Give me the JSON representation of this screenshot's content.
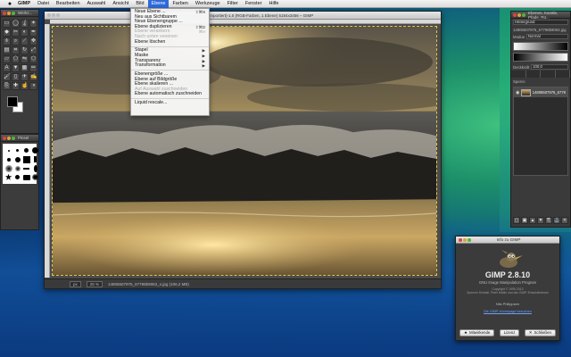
{
  "menubar": {
    "apple": "",
    "app": "GIMP",
    "items": [
      "Datei",
      "Bearbeiten",
      "Auswahl",
      "Ansicht",
      "Bild",
      "Ebene",
      "Farben",
      "Werkzeuge",
      "Filter",
      "Fenster",
      "Hilfe"
    ],
    "active": "Ebene"
  },
  "toolbox": {
    "title": "Werkz..."
  },
  "brushes": {
    "title": "Pinsel"
  },
  "image_window": {
    "title": "[14806...] (importiert)-1.0 (RGB-Farben, 1 Ebene) 5184x3456 – GIMP",
    "status_unit": "px",
    "status_zoom": "25 %",
    "status_file": "14806507975_67798b9063_o.jpg (106,2 MB)"
  },
  "ebene_menu": [
    {
      "label": "Neue Ebene ...",
      "shortcut": "⇧⌘N",
      "disabled": false
    },
    {
      "label": "Neu aus Sichtbarem",
      "shortcut": "",
      "disabled": false
    },
    {
      "label": "Neue Ebenengruppe ...",
      "shortcut": "",
      "disabled": false
    },
    {
      "label": "Ebene duplizieren",
      "shortcut": "⇧⌘D",
      "disabled": false
    },
    {
      "label": "Ebene verankern",
      "shortcut": "⌘H",
      "disabled": true
    },
    {
      "label": "Nach unten vereinen",
      "shortcut": "",
      "disabled": true
    },
    {
      "label": "Ebene löschen",
      "shortcut": "",
      "disabled": false
    },
    {
      "sep": true
    },
    {
      "label": "Stapel",
      "shortcut": "▶",
      "disabled": false
    },
    {
      "label": "Maske",
      "shortcut": "▶",
      "disabled": false
    },
    {
      "label": "Transparenz",
      "shortcut": "▶",
      "disabled": false
    },
    {
      "label": "Transformation",
      "shortcut": "▶",
      "disabled": false
    },
    {
      "sep": true
    },
    {
      "label": "Ebenengröße ...",
      "shortcut": "",
      "disabled": false
    },
    {
      "label": "Ebene auf Bildgröße",
      "shortcut": "",
      "disabled": false
    },
    {
      "label": "Ebene skalieren ...",
      "shortcut": "",
      "disabled": false
    },
    {
      "label": "Auf Auswahl zuschneiden",
      "shortcut": "",
      "disabled": true
    },
    {
      "label": "Ebene automatisch zuschneiden",
      "shortcut": "",
      "disabled": false
    },
    {
      "sep": true
    },
    {
      "label": "Liquid rescale...",
      "shortcut": "",
      "disabled": false
    }
  ],
  "layers": {
    "title": "Ebenen, Kanäle, Pfade, Rü...",
    "dock_label": "Hintergrund",
    "image_label": "14806507975_67798b9063.jpg",
    "mode_label": "Modus",
    "mode_value": "Normal",
    "opacity_label": "Deckkraft",
    "opacity_value": "100,0",
    "lock_label": "Sperre:",
    "layer_name": "14806507975_6779"
  },
  "about": {
    "title": "Info zu GIMP",
    "version": "GIMP 2.8.10",
    "subtitle": "GNU Image Manipulation Program",
    "copyright": "Copyright © 1995-2013\nSpencer Kimball, Peter Mattis und das GIMP-Entwicklerteam",
    "translator": "Nils Philippsen",
    "link": "Die GIMP-Homepage besuchen",
    "btn_credits": "Mitwirkende",
    "btn_license": "Lizenz",
    "btn_close": "Schließen"
  }
}
